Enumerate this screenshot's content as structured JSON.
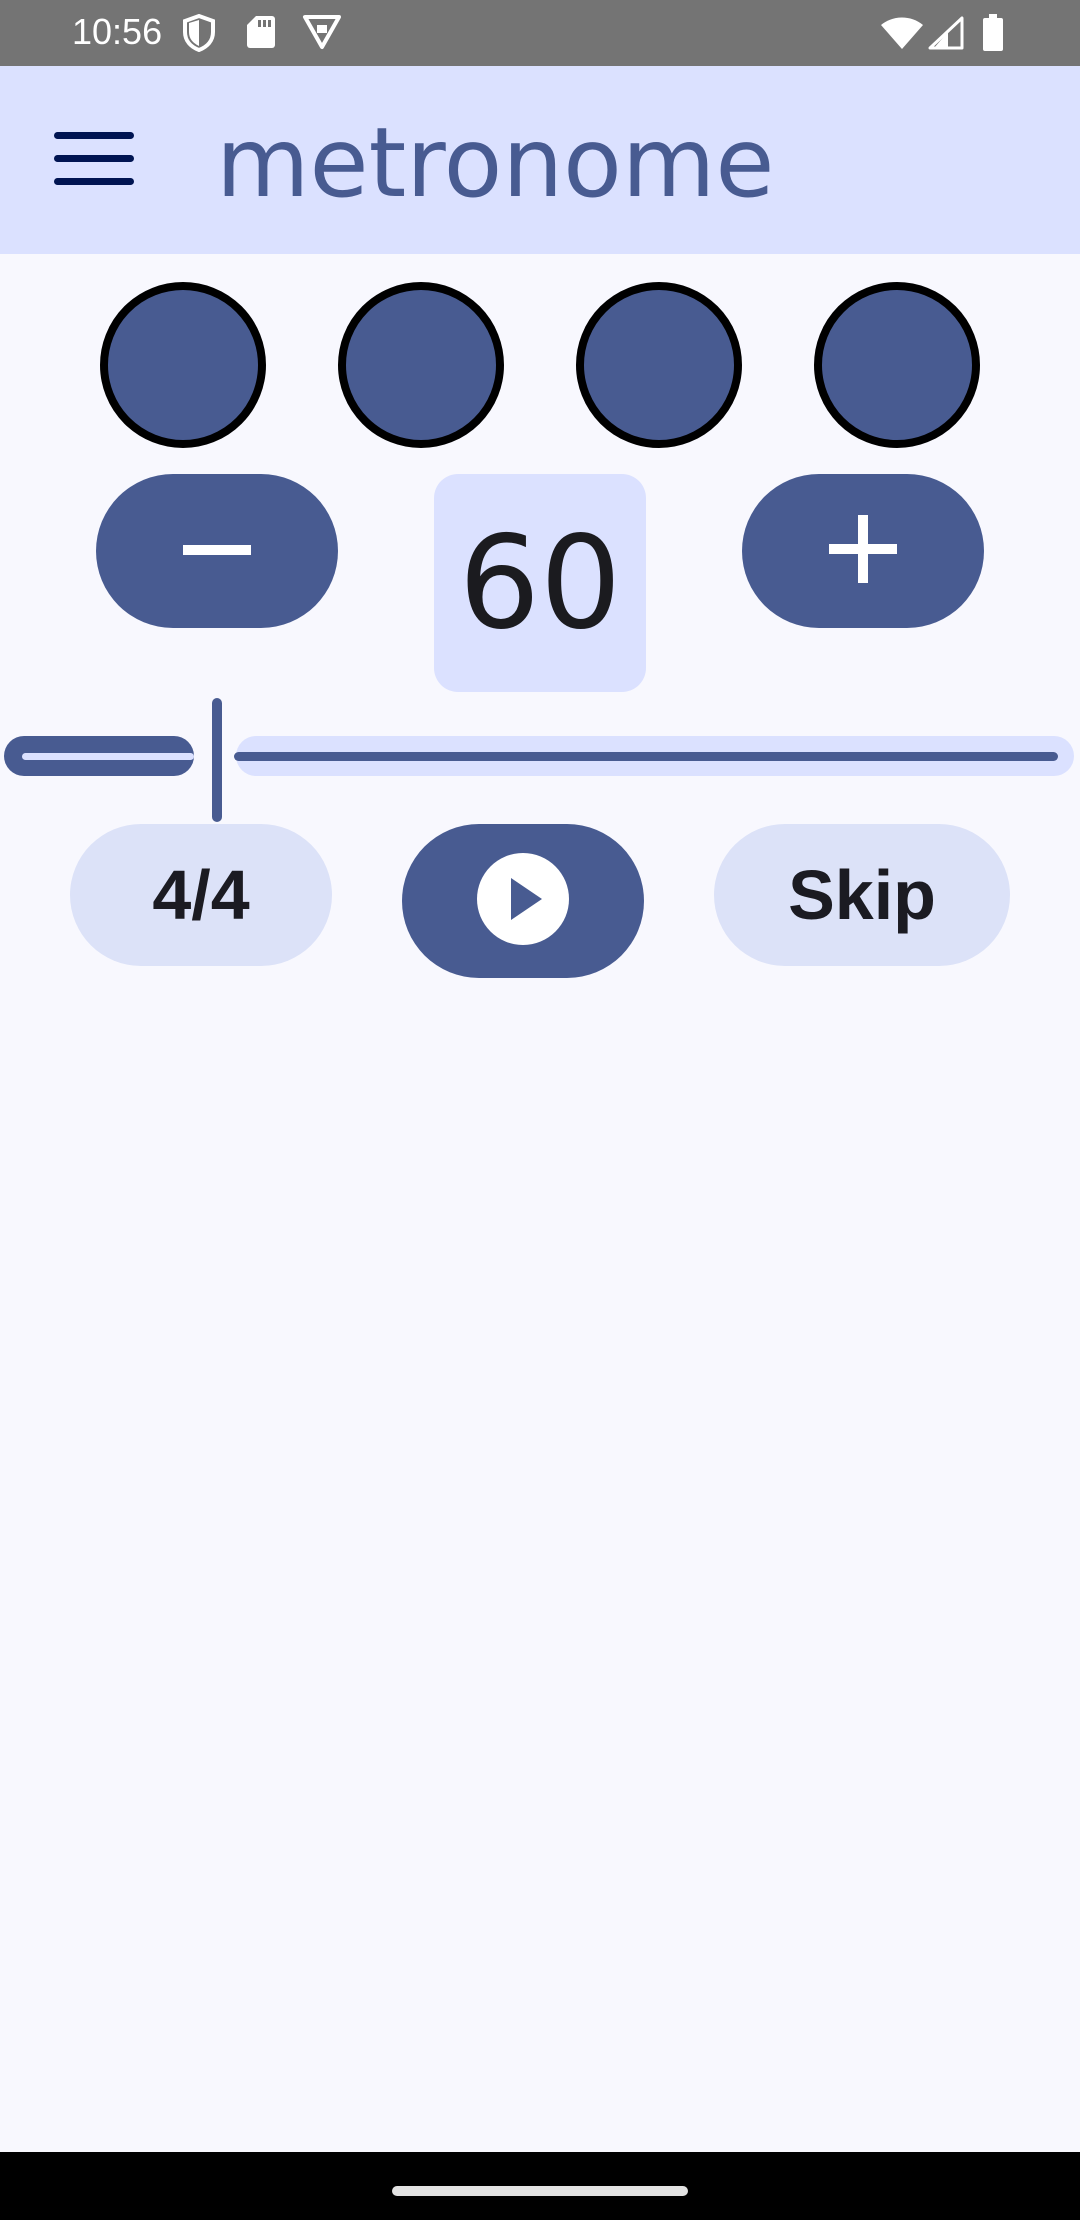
{
  "status_bar": {
    "time": "10:56",
    "icons": [
      "shield-icon",
      "sd-card-icon",
      "vpn-badge-icon",
      "wifi-icon",
      "signal-icon",
      "battery-icon"
    ]
  },
  "app_bar": {
    "title": "metronome",
    "menu_icon": "hamburger-menu-icon"
  },
  "beats": [
    {
      "state": "inactive"
    },
    {
      "state": "inactive"
    },
    {
      "state": "inactive"
    },
    {
      "state": "inactive"
    }
  ],
  "tempo": {
    "value": "60",
    "decrement_icon": "minus-icon",
    "increment_icon": "plus-icon",
    "slider_level_fraction": 0.19
  },
  "controls": {
    "time_signature": "4/4",
    "play_icon": "play-circle-icon",
    "skip_label": "Skip"
  },
  "colors": {
    "primary": "#485B91",
    "primary_container": "#DBE1FF",
    "secondary_container": "#DCE2F8",
    "background": "#F8F8FE",
    "status_bar": "#747474"
  }
}
